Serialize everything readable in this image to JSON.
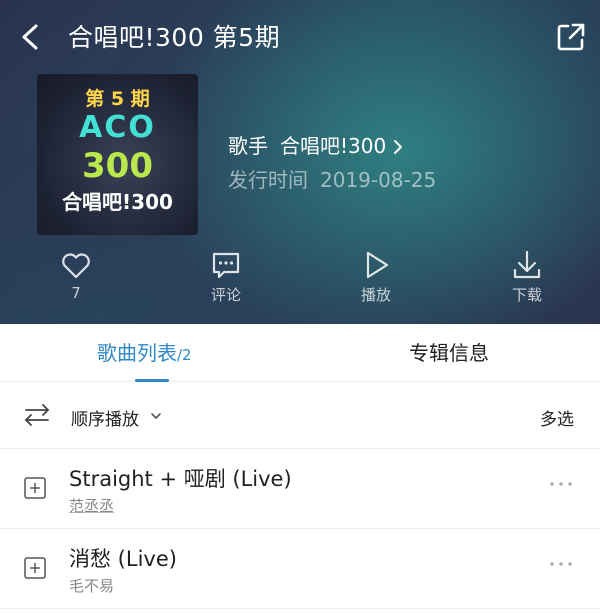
{
  "header": {
    "title": "合唱吧!300 第5期",
    "cover": {
      "issue": "第 5 期",
      "logo_line1": "ACO",
      "logo_line2": "300",
      "brand": "合唱吧!300"
    },
    "artist_label": "歌手",
    "artist_name": "合唱吧!300",
    "date_label": "发行时间",
    "release_date": "2019-08-25"
  },
  "actions": [
    {
      "icon": "heart-icon",
      "label": "7"
    },
    {
      "icon": "comment-icon",
      "label": "评论"
    },
    {
      "icon": "play-icon",
      "label": "播放"
    },
    {
      "icon": "download-icon",
      "label": "下载"
    }
  ],
  "tabs": {
    "songs_label": "歌曲列表",
    "songs_count": "/2",
    "info_label": "专辑信息"
  },
  "toolbar": {
    "order_label": "顺序播放",
    "multi_select_label": "多选"
  },
  "songs": [
    {
      "title": "Straight + 哑剧 (Live)",
      "artist": "范丞丞"
    },
    {
      "title": "消愁 (Live)",
      "artist": "毛不易"
    }
  ],
  "colors": {
    "accent": "#2f88c8",
    "header_bg_dark": "#2a2f4a",
    "header_bg_teal": "#2f7f82"
  }
}
